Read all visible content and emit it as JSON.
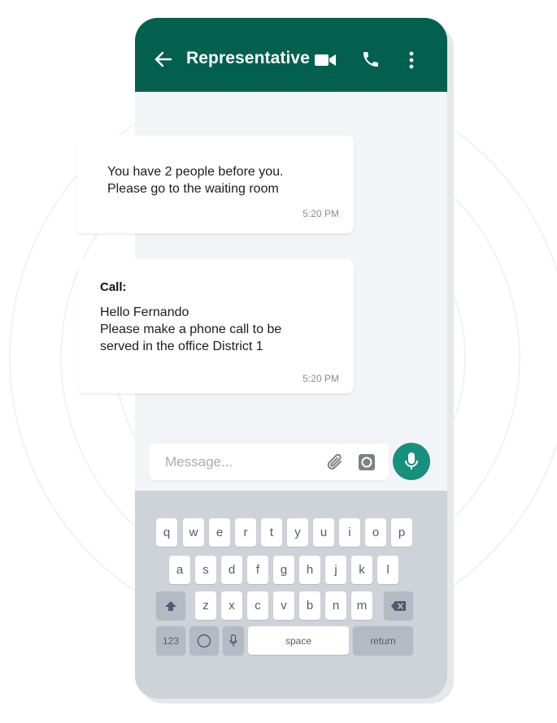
{
  "header": {
    "title": "Representative"
  },
  "messages": [
    {
      "title": "",
      "text": "You have 2 people before you.\nPlease go to the waiting room",
      "time": "5:20 PM"
    },
    {
      "title": "Call:",
      "text": "Hello Fernando\nPlease make a phone call to be\nserved in the office District 1",
      "time": "5:20 PM"
    }
  ],
  "composer": {
    "placeholder": "Message..."
  },
  "keyboard": {
    "row1": [
      "q",
      "w",
      "e",
      "r",
      "t",
      "y",
      "u",
      "i",
      "o",
      "p"
    ],
    "row2": [
      "a",
      "s",
      "d",
      "f",
      "g",
      "h",
      "j",
      "k",
      "l"
    ],
    "row3": [
      "z",
      "x",
      "c",
      "v",
      "b",
      "n",
      "m"
    ],
    "num_label": "123",
    "space_label": "space",
    "return_label": "return"
  },
  "colors": {
    "header": "#03604f",
    "mic_button": "#17907e",
    "keyboard_bg": "#ced2d9",
    "chat_bg": "#f3f4f7"
  },
  "icons": {
    "back": "arrow-left-icon",
    "video": "video-camera-icon",
    "call": "phone-icon",
    "menu": "more-vertical-icon",
    "attach": "paperclip-icon",
    "camera": "camera-icon",
    "mic": "microphone-icon",
    "shift": "shift-icon",
    "backspace": "backspace-icon",
    "emoji": "emoji-icon",
    "voice": "microphone-icon"
  }
}
